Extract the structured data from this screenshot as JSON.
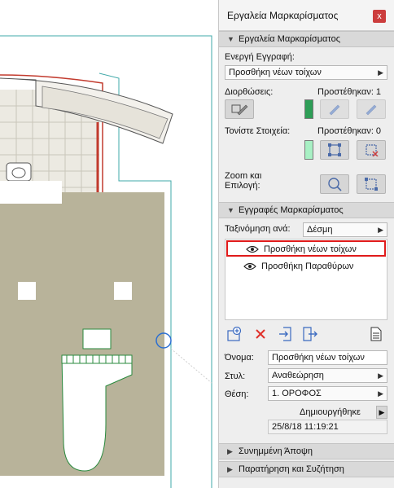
{
  "palette": {
    "title": "Εργαλεία Μαρκαρίσματος",
    "close_symbol": "x",
    "tools_section": {
      "header": "Εργαλεία Μαρκαρίσματος",
      "active_entry_label": "Ενεργή Εγγραφή:",
      "active_entry_value": "Προσθήκη νέων τοίχων",
      "corrections_label": "Διορθώσεις:",
      "corrections_added": "Προστέθηκαν: 1",
      "corrections_color": "#2e9e57",
      "highlight_label": "Τονίστε Στοιχεία:",
      "highlight_added": "Προστέθηκαν: 0",
      "highlight_color": "#a8f0c4",
      "zoom_label_line1": "Zoom και",
      "zoom_label_line2": "Επιλογή:"
    },
    "entries_section": {
      "header": "Εγγραφές Μαρκαρίσματος",
      "sort_label": "Ταξινόμηση ανά:",
      "sort_value": "Δέσμη",
      "items": [
        {
          "label": "Προσθήκη νέων τοίχων",
          "selected": true,
          "icon": "eye-icon"
        },
        {
          "label": "Προσθήκη Παραθύρων",
          "selected": false,
          "icon": "eye-icon"
        }
      ],
      "name_label": "Όνομα:",
      "name_value": "Προσθήκη νέων τοίχων",
      "style_label": "Στυλ:",
      "style_value": "Αναθεώρηση",
      "position_label": "Θέση:",
      "position_value": "1. ΟΡΟΦΟΣ",
      "created_label": "Δημιουργήθηκε",
      "created_value": "25/8/18 11:19:21"
    },
    "attached_view_header": "Συνημμένη Άποψη",
    "comments_header": "Παρατήρηση και Συζήτηση"
  },
  "colors": {
    "floor_fill": "#b8b39a",
    "selection_red": "#e01b1b",
    "wall_red": "#c23b2e",
    "plan_green": "#2a8a3e",
    "cursor_blue": "#2c6fd1",
    "boundary_teal": "#3fa8a8"
  }
}
